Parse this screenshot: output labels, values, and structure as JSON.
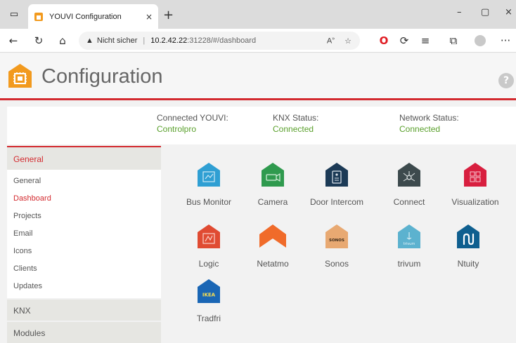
{
  "browser": {
    "tab_title": "YOUVI Configuration",
    "tab_close": "×",
    "new_tab": "+",
    "address_warning": "Nicht sicher",
    "address_separator": "|",
    "address_host": "10.2.42.22",
    "address_path": ":31228/#/dashboard",
    "minimize": "–",
    "maximize": "▢",
    "close": "×",
    "more": "···"
  },
  "header": {
    "title": "Configuration",
    "help": "?"
  },
  "status": {
    "connected_label": "Connected YOUVI:",
    "connected_value": "Controlpro",
    "knx_label": "KNX Status:",
    "knx_value": "Connected",
    "network_label": "Network Status:",
    "network_value": "Connected"
  },
  "sidebar": {
    "general_header": "General",
    "items": [
      {
        "label": "General"
      },
      {
        "label": "Dashboard"
      },
      {
        "label": "Projects"
      },
      {
        "label": "Email"
      },
      {
        "label": "Icons"
      },
      {
        "label": "Clients"
      },
      {
        "label": "Updates"
      }
    ],
    "knx_header": "KNX",
    "modules_header": "Modules"
  },
  "tiles": [
    {
      "label": "Bus Monitor",
      "color": "#2f9fd3"
    },
    {
      "label": "Camera",
      "color": "#2f9a4e"
    },
    {
      "label": "Door Intercom",
      "color": "#1c3a56"
    },
    {
      "label": "Connect",
      "color": "#3d4a4d"
    },
    {
      "label": "Visualization",
      "color": "#d81f3f"
    },
    {
      "label": "Logic",
      "color": "#e04b32"
    },
    {
      "label": "Netatmo",
      "color": "#f06b2a"
    },
    {
      "label": "Sonos",
      "color": "#e8a972",
      "badge": "SONOS"
    },
    {
      "label": "trivum",
      "color": "#5cb2cf",
      "badge": "trivum"
    },
    {
      "label": "Ntuity",
      "color": "#0f5f8f"
    },
    {
      "label": "Tradfri",
      "color": "#1a66b5",
      "badge": "IKEA"
    }
  ],
  "colors": {
    "accent": "#d32a2f",
    "status_ok": "#5aa02c"
  }
}
